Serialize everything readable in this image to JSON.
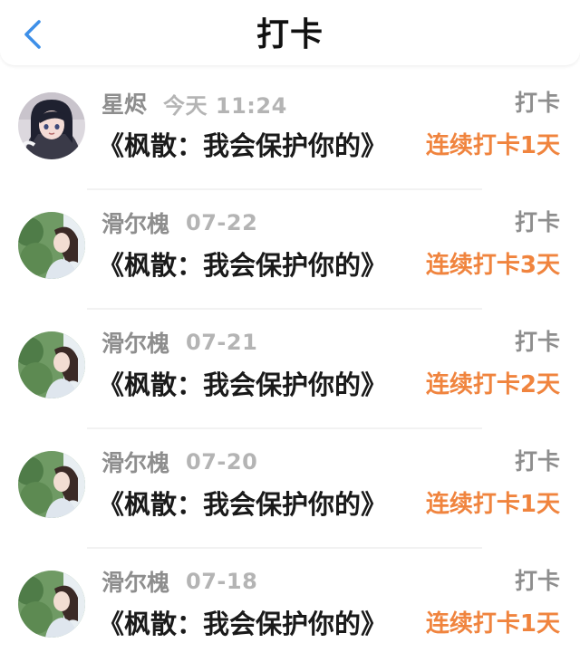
{
  "header": {
    "title": "打卡",
    "back_icon": "chevron-left-icon",
    "accent": "#3d8fe8"
  },
  "colors": {
    "streak": "#f0843e",
    "meta_text": "#8e8e8e",
    "time_text": "#b4b4b4"
  },
  "records": [
    {
      "user": "星烬",
      "time": "今天 11:24",
      "action": "打卡",
      "book": "《枫散：我会保护你的》",
      "streak": "连续打卡1天",
      "avatar": "anime-girl-avatar"
    },
    {
      "user": "滑尔槐",
      "time": "07-22",
      "action": "打卡",
      "book": "《枫散：我会保护你的》",
      "streak": "连续打卡3天",
      "avatar": "photo-girl-avatar"
    },
    {
      "user": "滑尔槐",
      "time": "07-21",
      "action": "打卡",
      "book": "《枫散：我会保护你的》",
      "streak": "连续打卡2天",
      "avatar": "photo-girl-avatar"
    },
    {
      "user": "滑尔槐",
      "time": "07-20",
      "action": "打卡",
      "book": "《枫散：我会保护你的》",
      "streak": "连续打卡1天",
      "avatar": "photo-girl-avatar"
    },
    {
      "user": "滑尔槐",
      "time": "07-18",
      "action": "打卡",
      "book": "《枫散：我会保护你的》",
      "streak": "连续打卡1天",
      "avatar": "photo-girl-avatar"
    }
  ]
}
